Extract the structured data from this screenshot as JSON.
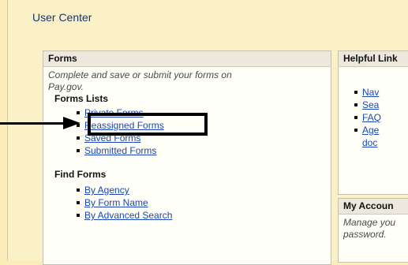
{
  "page_title": "User Center",
  "forms_panel": {
    "heading": "Forms",
    "description_lines": [
      "Complete and save or submit your forms on",
      "Pay.gov."
    ],
    "forms_lists_heading": "Forms Lists",
    "forms_lists": [
      "Private Forms",
      "Reassigned Forms",
      "Saved Forms",
      "Submitted Forms"
    ],
    "find_forms_heading": "Find Forms",
    "find_forms": [
      "By Agency",
      "By Form Name",
      "By Advanced Search"
    ]
  },
  "helpful_links_panel": {
    "heading": "Helpful Link",
    "links": [
      {
        "line1": "Nav"
      },
      {
        "line1": "Sea"
      },
      {
        "line1": "FAQ"
      },
      {
        "line1": "Age",
        "line2": "doc"
      }
    ]
  },
  "account_panel": {
    "heading": "My Accoun",
    "description_lines": [
      "Manage you",
      "password."
    ]
  }
}
